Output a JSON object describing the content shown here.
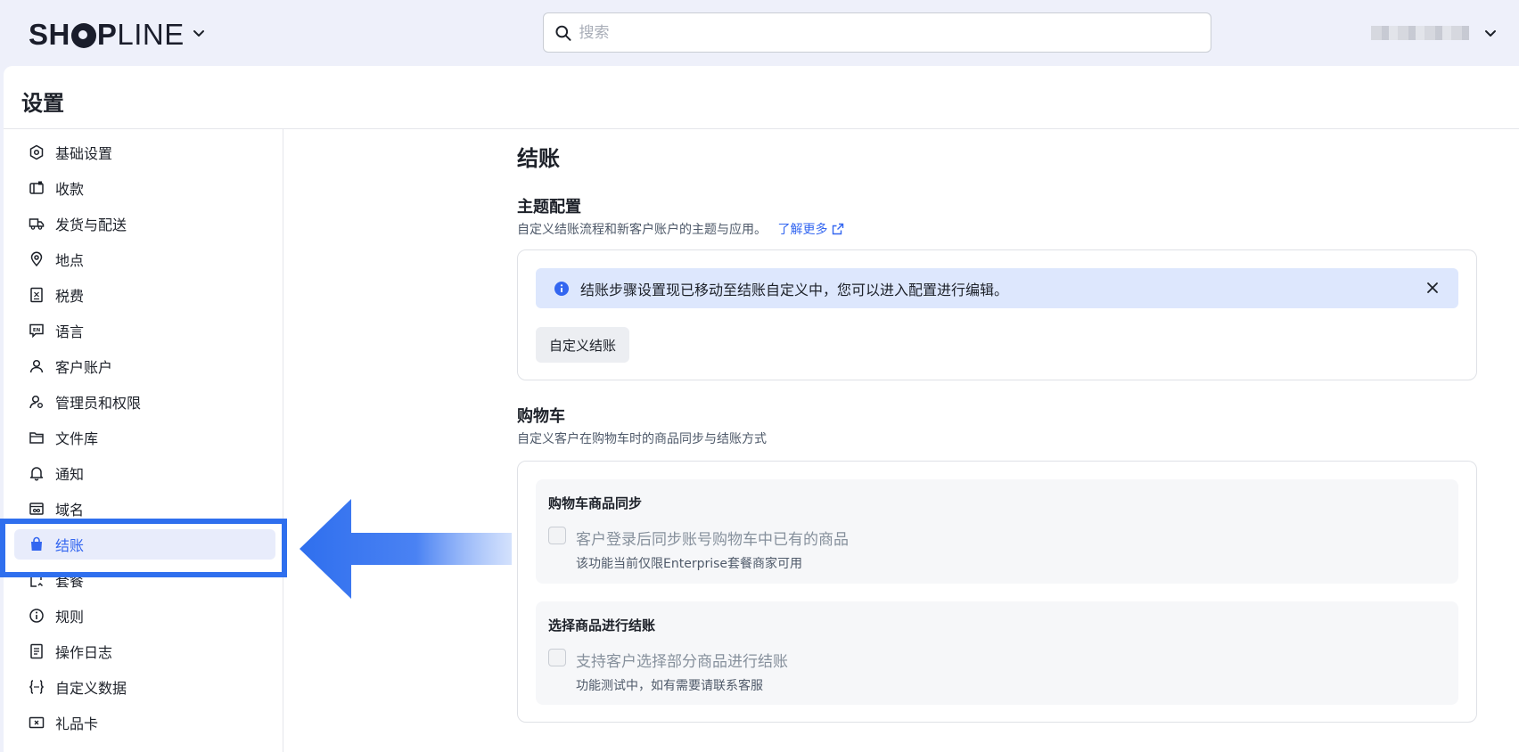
{
  "header": {
    "logo_text_bold": "SH",
    "logo_text_mid": "P",
    "logo_text_light": "LINE",
    "search_placeholder": "搜索"
  },
  "page": {
    "title": "设置"
  },
  "sidebar": {
    "items": [
      {
        "label": "基础设置",
        "icon": "hexagon-settings-icon"
      },
      {
        "label": "收款",
        "icon": "wallet-icon"
      },
      {
        "label": "发货与配送",
        "icon": "truck-icon"
      },
      {
        "label": "地点",
        "icon": "location-pin-icon"
      },
      {
        "label": "税费",
        "icon": "tax-receipt-icon"
      },
      {
        "label": "语言",
        "icon": "language-icon"
      },
      {
        "label": "客户账户",
        "icon": "user-icon"
      },
      {
        "label": "管理员和权限",
        "icon": "user-admin-icon"
      },
      {
        "label": "文件库",
        "icon": "folder-icon"
      },
      {
        "label": "通知",
        "icon": "bell-icon"
      },
      {
        "label": "域名",
        "icon": "domain-icon"
      },
      {
        "label": "结账",
        "icon": "shopping-bag-icon",
        "active": true
      },
      {
        "label": "套餐",
        "icon": "plan-icon"
      },
      {
        "label": "规则",
        "icon": "info-circle-icon"
      },
      {
        "label": "操作日志",
        "icon": "log-icon"
      },
      {
        "label": "自定义数据",
        "icon": "custom-data-icon"
      },
      {
        "label": "礼品卡",
        "icon": "gift-card-icon"
      }
    ]
  },
  "content": {
    "title": "结账",
    "theme": {
      "heading": "主题配置",
      "description": "自定义结账流程和新客户账户的主题与应用。",
      "link": "了解更多",
      "notice": "结账步骤设置现已移动至结账自定义中，您可以进入配置进行编辑。",
      "button": "自定义结账"
    },
    "cart": {
      "heading": "购物车",
      "description": "自定义客户在购物车时的商品同步与结账方式",
      "sync": {
        "title": "购物车商品同步",
        "checkbox_label": "客户登录后同步账号购物车中已有的商品",
        "hint": "该功能当前仅限Enterprise套餐商家可用"
      },
      "select": {
        "title": "选择商品进行结账",
        "checkbox_label": "支持客户选择部分商品进行结账",
        "hint": "功能测试中，如有需要请联系客服"
      }
    }
  },
  "colors": {
    "accent": "#3366f0",
    "highlight": "#2f6fee"
  }
}
